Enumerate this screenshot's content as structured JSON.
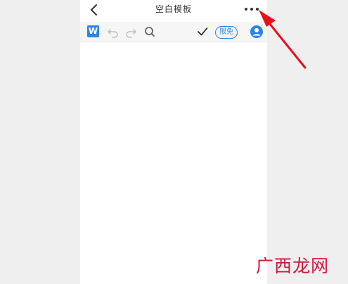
{
  "header": {
    "title": "空白模板",
    "back_icon": "chevron-left-icon",
    "more_icon": "more-horizontal-icon"
  },
  "toolbar": {
    "logo_letter": "W",
    "limited_label": "限免",
    "icons": [
      "undo-icon",
      "redo-icon",
      "search-icon",
      "check-icon",
      "avatar-icon"
    ]
  },
  "overlay": {
    "arrow_color": "#e8101c"
  },
  "watermark": {
    "text": "广西龙网"
  },
  "colors": {
    "accent": "#2a85e8",
    "watermark": "#d2143a"
  }
}
